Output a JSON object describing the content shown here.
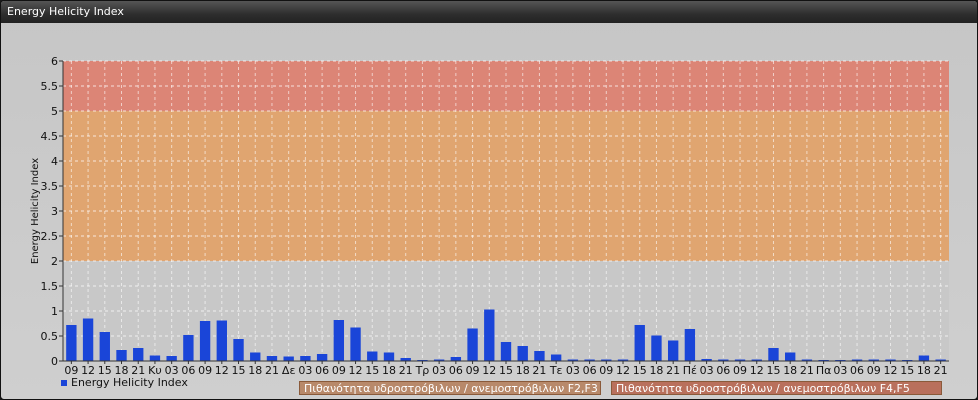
{
  "window": {
    "title": "Energy Helicity Index"
  },
  "legend": {
    "series_label": "Energy Helicity Index"
  },
  "probability_boxes": [
    "Πιθανότητα υδροστρόβιλων / ανεμοστρόβιλων F2,F3",
    "Πιθανότητα υδροστρόβιλων / ανεμοστρόβιλων F4,F5"
  ],
  "colors": {
    "bar": "#1a45d8",
    "zone_low": "#c8c8c8",
    "zone_mid": "#e1a36c",
    "zone_high": "#dd8272"
  },
  "chart_data": {
    "type": "bar",
    "ylabel": "Energy Helicity Index",
    "xlabel": "",
    "ylim": [
      0,
      6
    ],
    "yticks": [
      0,
      0.5,
      1,
      1.5,
      2,
      2.5,
      3,
      3.5,
      4,
      4.5,
      5,
      5.5,
      6
    ],
    "grid": true,
    "zones": [
      {
        "from": 0,
        "to": 2,
        "color": "#c8c8c8"
      },
      {
        "from": 2,
        "to": 5,
        "color": "#e1a36c"
      },
      {
        "from": 5,
        "to": 6,
        "color": "#dd8272"
      }
    ],
    "categories": [
      "09",
      "12",
      "15",
      "18",
      "21",
      "Κυ",
      "03",
      "06",
      "09",
      "12",
      "15",
      "18",
      "21",
      "Δε",
      "03",
      "06",
      "09",
      "12",
      "15",
      "18",
      "21",
      "Τρ",
      "03",
      "06",
      "09",
      "12",
      "15",
      "18",
      "21",
      "Τε",
      "03",
      "06",
      "09",
      "12",
      "15",
      "18",
      "21",
      "Πέ",
      "03",
      "06",
      "09",
      "12",
      "15",
      "18",
      "21",
      "Πα",
      "03",
      "06",
      "09",
      "12",
      "15",
      "18",
      "21"
    ],
    "series": [
      {
        "name": "Energy Helicity Index",
        "values": [
          0.72,
          0.85,
          0.58,
          0.22,
          0.26,
          0.11,
          0.1,
          0.52,
          0.8,
          0.81,
          0.44,
          0.17,
          0.1,
          0.09,
          0.1,
          0.14,
          0.82,
          0.67,
          0.19,
          0.17,
          0.06,
          0.02,
          0.03,
          0.08,
          0.65,
          1.03,
          0.38,
          0.3,
          0.2,
          0.13,
          0.03,
          0.03,
          0.03,
          0.03,
          0.72,
          0.51,
          0.41,
          0.64,
          0.04,
          0.03,
          0.03,
          0.03,
          0.26,
          0.17,
          0.03,
          0.02,
          0.02,
          0.03,
          0.03,
          0.03,
          0.02,
          0.11,
          0.03
        ]
      }
    ]
  }
}
